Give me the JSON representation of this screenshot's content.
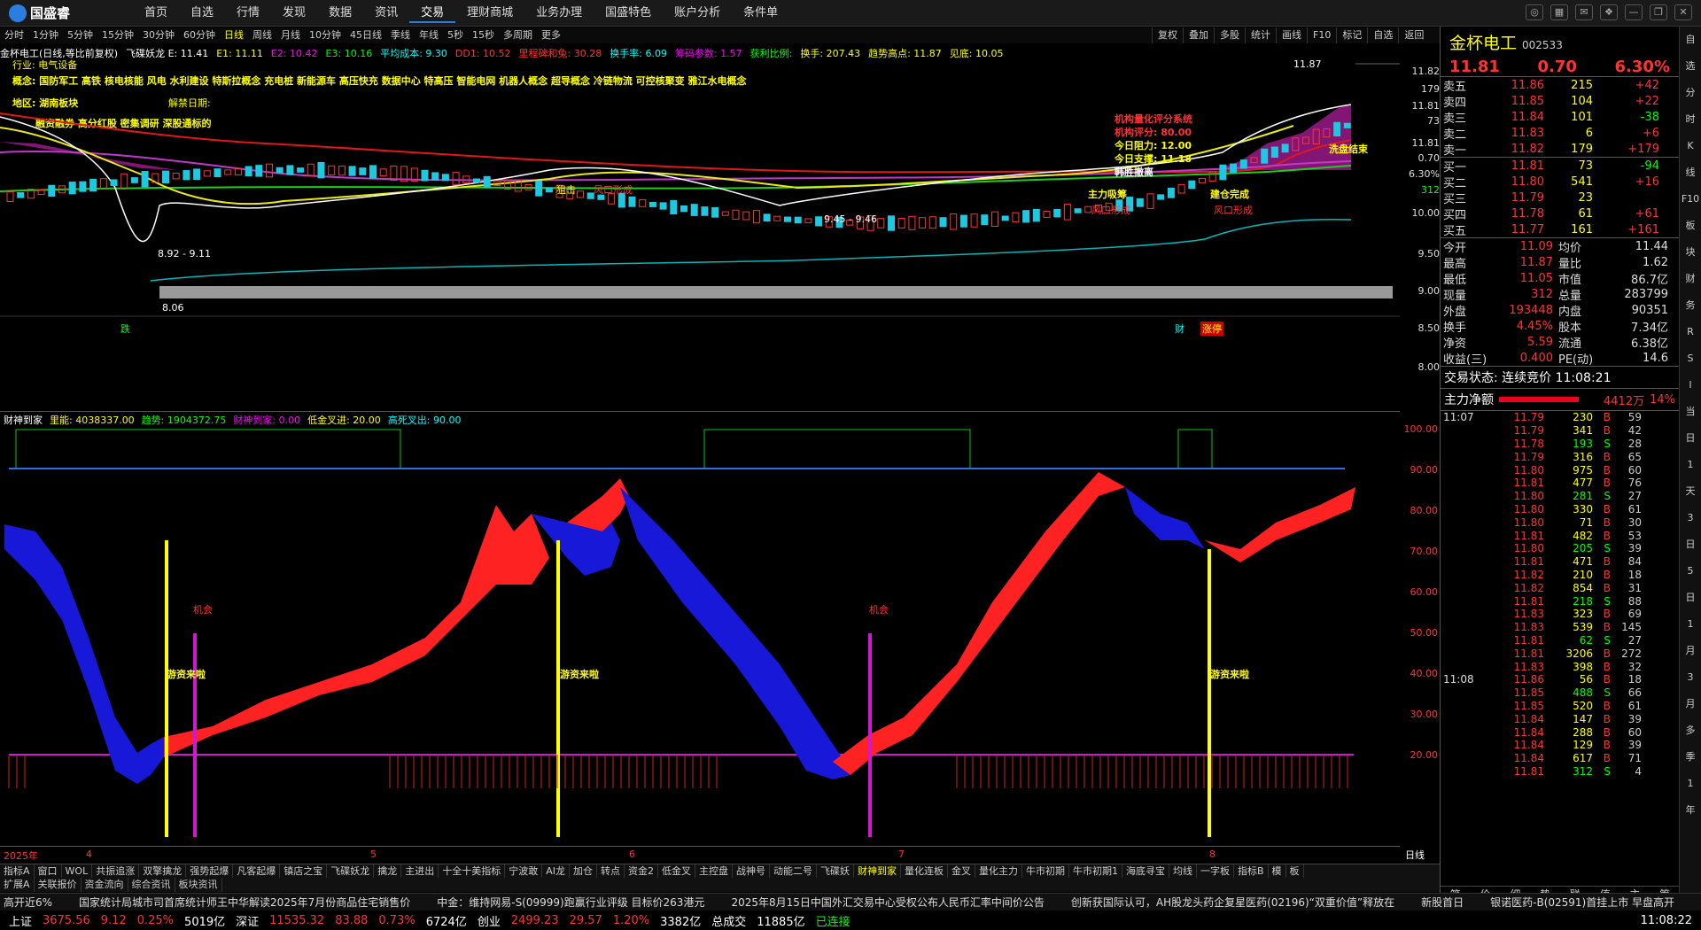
{
  "app": {
    "logo": "国盛睿",
    "nav": [
      "首页",
      "自选",
      "行情",
      "发现",
      "数据",
      "资讯",
      "交易",
      "理财商城",
      "业务办理",
      "国盛特色",
      "账户分析",
      "条件单"
    ],
    "active_nav": "交易"
  },
  "periods": [
    "分时",
    "1分钟",
    "5分钟",
    "15分钟",
    "30分钟",
    "60分钟",
    "日线",
    "周线",
    "月线",
    "10分钟",
    "45日线",
    "季线",
    "年线",
    "5秒",
    "15秒",
    "多周期",
    "更多"
  ],
  "active_period": "日线",
  "right_tools": [
    "复权",
    "叠加",
    "多股",
    "统计",
    "画线",
    "F10",
    "标记",
    "自选",
    "返回"
  ],
  "indicator_line": [
    {
      "t": "金杯电工(日线,等比前复权)",
      "c": "#fff"
    },
    {
      "t": "飞碟妖龙 E: 11.41",
      "c": "#fff"
    },
    {
      "t": "E1: 11.11",
      "c": "#ff0"
    },
    {
      "t": "E2: 10.42",
      "c": "#f0f"
    },
    {
      "t": "E3: 10.16",
      "c": "#0f0"
    },
    {
      "t": "平均成本: 9.30",
      "c": "#0ff"
    },
    {
      "t": "DD1: 10.52",
      "c": "#f33"
    },
    {
      "t": "里程碑和兔: 30.28",
      "c": "#f33"
    },
    {
      "t": "换手率: 6.09",
      "c": "#0ff"
    },
    {
      "t": "筹码参数: 1.57",
      "c": "#f0f"
    },
    {
      "t": "获利比例:",
      "c": "#0f0"
    },
    {
      "t": "换手: 207.43",
      "c": "#ff0"
    },
    {
      "t": "趋势高点: 11.87",
      "c": "#ff0"
    },
    {
      "t": "见底: 10.05",
      "c": "#ff0"
    }
  ],
  "info": {
    "industry": "行业: 电气设备",
    "concept": "概念: 国防军工 高铁 核电核能 风电 水利建设 特斯拉概念 充电桩 新能源车 高压快充 数据中心 特高压 智能电网 机器人概念 超导概念 冷链物流 可控核聚变 雅江水电概念",
    "region": "地区: 湖南板块",
    "unban": "解禁日期:",
    "tags": "融资融券 高分红股 密集调研 深股通标的"
  },
  "annotations": {
    "inst_title": "机构量化评分系统",
    "inst_score": "机构评分: 80.00",
    "resist": "今日阻力: 12.00",
    "support": "今日支撑: 11.18",
    "jiaocha": "韩胜撤离",
    "wash": "洗盘结束",
    "main_buy": "主力吸筹",
    "build": "建仓完成",
    "wind1": "风口形成",
    "wind2": "风口形成",
    "wind3": "风口形成",
    "lbl1": "8.92 - 9.11",
    "lbl2": "9.45 - 9.46",
    "low": "8.06",
    "high": "11.87",
    "die": "跌",
    "cai": "财",
    "zt": "涨停",
    "zhang": "涨",
    "hit": "狙击"
  },
  "price_axis": [
    "11.82",
    "11.81",
    "11.81",
    "10.00",
    "9.50",
    "9.00",
    "8.50",
    "8.00"
  ],
  "vol_axis_small": [
    "179",
    "73",
    "312"
  ],
  "axis_tags": {
    "p1": "0.70",
    "p2": "6.30%"
  },
  "sub_indicator": {
    "title": "财神到家",
    "a": "里能: 4038337.00",
    "b": "趋势: 1904372.75",
    "c": "财神到家: 0.00",
    "d": "低金叉进: 20.00",
    "e": "高死叉出: 90.00",
    "chance": "机会",
    "fund": "游资来啦"
  },
  "sub_axis": [
    "100.00",
    "90.00",
    "80.00",
    "70.00",
    "60.00",
    "50.00",
    "40.00",
    "30.00",
    "20.00"
  ],
  "dates": [
    "2025年",
    "4",
    "5",
    "6",
    "7",
    "8"
  ],
  "date_axis_label": "日线",
  "bottom_tabs": [
    "指标A",
    "窗口",
    "WOL",
    "共振追涨",
    "双擎擒龙",
    "强势起爆",
    "凡客起爆",
    "镇店之宝",
    "飞碟妖龙",
    "擒龙",
    "主进出",
    "十全十美指标",
    "宁波敢",
    "AI龙",
    "加仓",
    "转点",
    "资金2",
    "低金叉",
    "主控盘",
    "战神号",
    "动能二号",
    "飞碟妖",
    "财神到家",
    "量化连板",
    "金叉",
    "量化主力",
    "牛市初期",
    "牛市初期1",
    "海底寻宝",
    "均线",
    "一字板",
    "指标B",
    "模",
    "板"
  ],
  "bottom_tabs2": [
    "扩展A",
    "关联报价",
    "资金流向",
    "综合资讯",
    "板块资讯"
  ],
  "quote": {
    "name": "金杯电工",
    "code": "002533",
    "price": "11.81",
    "chg": "0.70",
    "pct": "6.30%",
    "asks": [
      [
        "卖五",
        "11.86",
        "215",
        "+42"
      ],
      [
        "卖四",
        "11.85",
        "104",
        "+22"
      ],
      [
        "卖三",
        "11.84",
        "101",
        "-38"
      ],
      [
        "卖二",
        "11.83",
        "6",
        "+6"
      ],
      [
        "卖一",
        "11.82",
        "179",
        "+179"
      ]
    ],
    "bids": [
      [
        "买一",
        "11.81",
        "73",
        "-94"
      ],
      [
        "买二",
        "11.80",
        "541",
        "+16"
      ],
      [
        "买三",
        "11.79",
        "23",
        ""
      ],
      [
        "买四",
        "11.78",
        "61",
        "+61"
      ],
      [
        "买五",
        "11.77",
        "161",
        "+161"
      ]
    ],
    "stats": [
      [
        "今开",
        "11.09",
        "均价",
        "11.44"
      ],
      [
        "最高",
        "11.87",
        "量比",
        "1.62"
      ],
      [
        "最低",
        "11.05",
        "市值",
        "86.7亿"
      ],
      [
        "现量",
        "312",
        "总量",
        "283799"
      ],
      [
        "外盘",
        "193448",
        "内盘",
        "90351"
      ],
      [
        "换手",
        "4.45%",
        "股本",
        "7.34亿"
      ],
      [
        "净资",
        "5.59",
        "流通",
        "6.38亿"
      ],
      [
        "收益(三)",
        "0.400",
        "PE(动)",
        "14.6"
      ]
    ],
    "state": "交易状态: 连续竞价 11:08:21",
    "net_label": "主力净额",
    "net_val": "4412万",
    "net_pct": "14%",
    "ticks_t1": "11:07",
    "ticks_t2": "11:08",
    "ticks": [
      [
        "11.79",
        "230",
        "B",
        "59"
      ],
      [
        "11.79",
        "341",
        "B",
        "42"
      ],
      [
        "11.78",
        "193",
        "S",
        "28"
      ],
      [
        "11.79",
        "316",
        "B",
        "65"
      ],
      [
        "11.80",
        "975",
        "B",
        "60"
      ],
      [
        "11.81",
        "477",
        "B",
        "76"
      ],
      [
        "11.80",
        "281",
        "S",
        "27"
      ],
      [
        "11.80",
        "330",
        "B",
        "61"
      ],
      [
        "11.80",
        "71",
        "B",
        "30"
      ],
      [
        "11.81",
        "482",
        "B",
        "53"
      ],
      [
        "11.80",
        "205",
        "S",
        "39"
      ],
      [
        "11.81",
        "471",
        "B",
        "84"
      ],
      [
        "11.82",
        "210",
        "B",
        "18"
      ],
      [
        "11.82",
        "854",
        "B",
        "31"
      ],
      [
        "11.81",
        "218",
        "S",
        "88"
      ],
      [
        "11.83",
        "323",
        "B",
        "69"
      ],
      [
        "11.83",
        "539",
        "B",
        "145"
      ],
      [
        "11.81",
        "62",
        "S",
        "27"
      ],
      [
        "11.81",
        "3206",
        "B",
        "272"
      ],
      [
        "11.83",
        "398",
        "B",
        "32"
      ],
      [
        "11.86",
        "56",
        "B",
        "18"
      ],
      [
        "11.85",
        "488",
        "S",
        "66"
      ],
      [
        "11.85",
        "520",
        "B",
        "61"
      ],
      [
        "11.84",
        "147",
        "B",
        "39"
      ],
      [
        "11.84",
        "288",
        "B",
        "60"
      ],
      [
        "11.84",
        "129",
        "B",
        "39"
      ],
      [
        "11.84",
        "617",
        "B",
        "71"
      ],
      [
        "11.81",
        "312",
        "S",
        "4"
      ]
    ],
    "rtabs": [
      "笔",
      "价",
      "细",
      "势",
      "联",
      "值",
      "主",
      "筹"
    ]
  },
  "sidebar": [
    "自",
    "选",
    "分",
    "时",
    "K",
    "线",
    "F10",
    "板",
    "块",
    "财",
    "务",
    "R",
    "S",
    "I",
    "当",
    "日",
    "1",
    "天",
    "3",
    "日",
    "5",
    "日",
    "1",
    "月",
    "3",
    "月",
    "多",
    "季",
    "1",
    "年"
  ],
  "news": [
    "高开近6%",
    "国家统计局城市司首席统计师王中华解读2025年7月份商品住宅销售价",
    "中金：维持网易-S(09999)跑赢行业评级 目标价263港元",
    "2025年8月15日中国外汇交易中心受权公布人民币汇率中间价公告",
    "创新获国际认可，AH股龙头药企复星医药(02196)“双重价值”释放在",
    "新股首日",
    "银诺医药-B(02591)首挂上市 早盘高开"
  ],
  "status": {
    "sh": "上证",
    "sh_v": "3675.56",
    "sh_c": "9.12",
    "sh_p": "0.25%",
    "sh_a": "5019亿",
    "sz": "深证",
    "sz_v": "11535.32",
    "sz_c": "83.88",
    "sz_p": "0.73%",
    "sz_a": "6724亿",
    "cy": "创业",
    "cy_v": "2499.23",
    "cy_c": "29.57",
    "cy_p": "1.20%",
    "cy_a": "3382亿",
    "tot": "总成交",
    "tot_v": "11885亿",
    "conn": "已连接",
    "time": "11:08:22"
  }
}
